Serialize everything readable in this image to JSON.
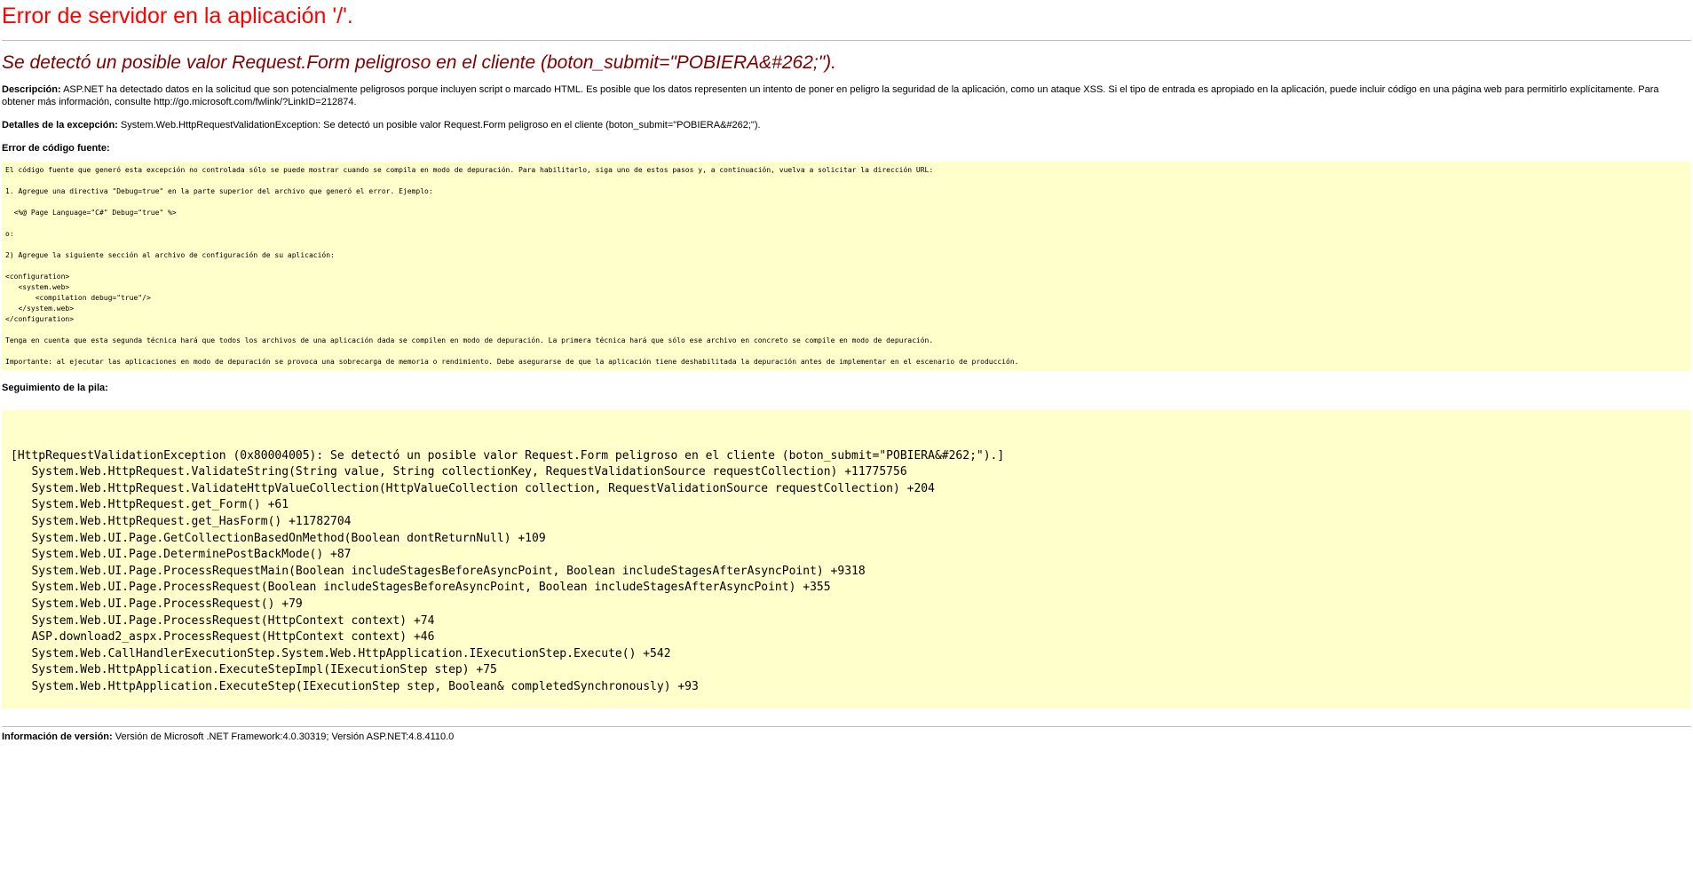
{
  "page": {
    "title": "Error de servidor en la aplicación '/'.",
    "subtitle": "Se detectó un posible valor Request.Form peligroso en el cliente (boton_submit=\"POBIERA&#262;\").",
    "description_label": "Descripción:",
    "description_text": "ASP.NET ha detectado datos en la solicitud que son potencialmente peligrosos porque incluyen script o marcado HTML. Es posible que los datos representen un intento de poner en peligro la seguridad de la aplicación, como un ataque XSS. Si el tipo de entrada es apropiado en la aplicación, puede incluir código en una página web para permitirlo explícitamente. Para obtener más información, consulte http://go.microsoft.com/fwlink/?LinkID=212874.",
    "exception_label": "Detalles de la excepción:",
    "exception_text": "System.Web.HttpRequestValidationException: Se detectó un posible valor Request.Form peligroso en el cliente (boton_submit=\"POBIERA&#262;\").",
    "source_error_label": "Error de código fuente:",
    "source_lines": [
      "El código fuente que generó esta excepción no controlada sólo se puede mostrar cuando se compila en modo de depuración. Para habilitarlo, siga uno de estos pasos y, a continuación, vuelva a solicitar la dirección URL:",
      "",
      "1. Agregue una directiva \"Debug=true\" en la parte superior del archivo que generó el error. Ejemplo:",
      "",
      "  <%@ Page Language=\"C#\" Debug=\"true\" %>",
      "",
      "o:",
      "",
      "2) Agregue la siguiente sección al archivo de configuración de su aplicación:",
      "",
      "<configuration>",
      "   <system.web>",
      "       <compilation debug=\"true\"/>",
      "   </system.web>",
      "</configuration>",
      "",
      "Tenga en cuenta que esta segunda técnica hará que todos los archivos de una aplicación dada se compilen en modo de depuración. La primera técnica hará que sólo ese archivo en concreto se compile en modo de depuración.",
      "",
      "Importante: al ejecutar las aplicaciones en modo de depuración se provoca una sobrecarga de memoria o rendimiento. Debe asegurarse de que la aplicación tiene deshabilitada la depuración antes de implementar en el escenario de producción."
    ],
    "stack_label": "Seguimiento de la pila:",
    "stack_lines": [
      "",
      "[HttpRequestValidationException (0x80004005): Se detectó un posible valor Request.Form peligroso en el cliente (boton_submit=\"POBIERA&#262;\").]",
      "   System.Web.HttpRequest.ValidateString(String value, String collectionKey, RequestValidationSource requestCollection) +11775756",
      "   System.Web.HttpRequest.ValidateHttpValueCollection(HttpValueCollection collection, RequestValidationSource requestCollection) +204",
      "   System.Web.HttpRequest.get_Form() +61",
      "   System.Web.HttpRequest.get_HasForm() +11782704",
      "   System.Web.UI.Page.GetCollectionBasedOnMethod(Boolean dontReturnNull) +109",
      "   System.Web.UI.Page.DeterminePostBackMode() +87",
      "   System.Web.UI.Page.ProcessRequestMain(Boolean includeStagesBeforeAsyncPoint, Boolean includeStagesAfterAsyncPoint) +9318",
      "   System.Web.UI.Page.ProcessRequest(Boolean includeStagesBeforeAsyncPoint, Boolean includeStagesAfterAsyncPoint) +355",
      "   System.Web.UI.Page.ProcessRequest() +79",
      "   System.Web.UI.Page.ProcessRequest(HttpContext context) +74",
      "   ASP.download2_aspx.ProcessRequest(HttpContext context) +46",
      "   System.Web.CallHandlerExecutionStep.System.Web.HttpApplication.IExecutionStep.Execute() +542",
      "   System.Web.HttpApplication.ExecuteStepImpl(IExecutionStep step) +75",
      "   System.Web.HttpApplication.ExecuteStep(IExecutionStep step, Boolean& completedSynchronously) +93"
    ],
    "version_label": "Información de versión:",
    "version_text": "Versión de Microsoft .NET Framework:4.0.30319; Versión ASP.NET:4.8.4110.0"
  },
  "colors": {
    "title": "#ff0000",
    "subtitle": "#800000",
    "code_background": "#ffffcc"
  }
}
